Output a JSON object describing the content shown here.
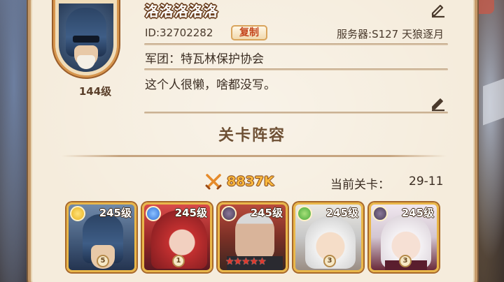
{
  "player": {
    "nickname": "洛洛洛洛洛",
    "level": "144级",
    "id_text": "ID:32702282",
    "copy_label": "复制",
    "server_text": "服务器:S127 天狼逐月",
    "guild_text": "军团：特瓦林保护协会",
    "signature": "这个人很懒，啥都没写。"
  },
  "lineup": {
    "title": "关卡阵容",
    "power": "8837K",
    "stage_label": "当前关卡：",
    "stage_value": "29-11",
    "heroes": [
      {
        "level": "245级",
        "element_icon": "sun-icon",
        "element_color": "#e8b21e",
        "badge": "5"
      },
      {
        "level": "245级",
        "element_icon": "water-icon",
        "element_color": "#2f6fd6",
        "badge": "1"
      },
      {
        "level": "245级",
        "element_icon": "dark-icon",
        "element_color": "#4a3b56",
        "stars": "★★★★★"
      },
      {
        "level": "245级",
        "element_icon": "wind-icon",
        "element_color": "#47a83a",
        "badge": "3"
      },
      {
        "level": "245级",
        "element_icon": "dark-icon",
        "element_color": "#4a3b56",
        "badge": "3"
      }
    ]
  }
}
